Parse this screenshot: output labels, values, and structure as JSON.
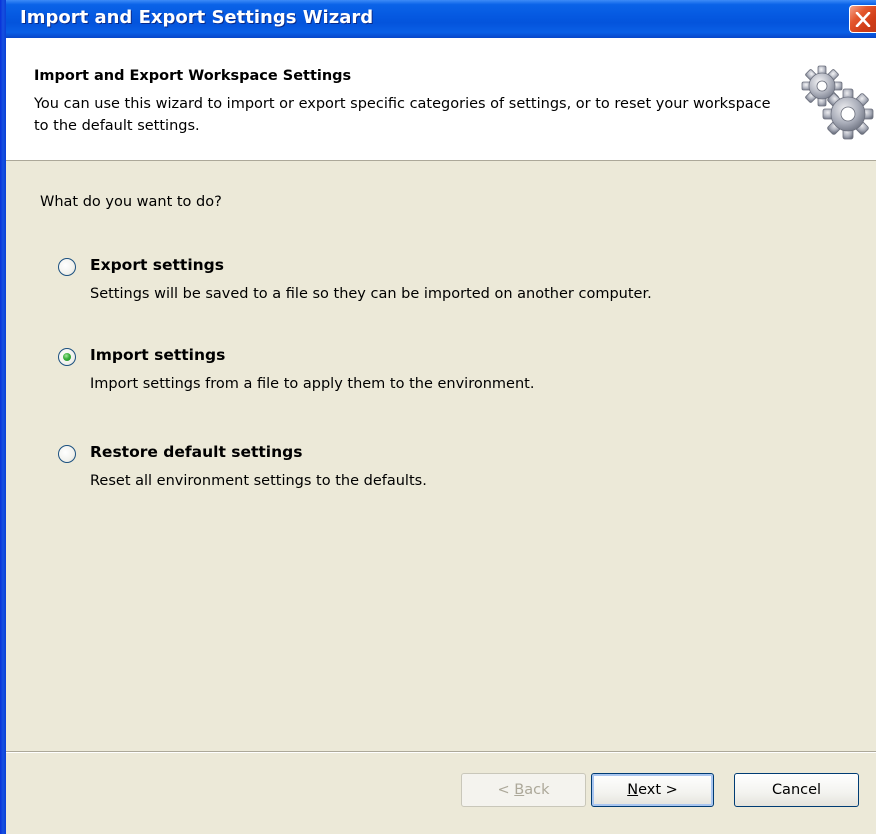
{
  "window": {
    "title": "Import and Export Settings Wizard",
    "close_icon": "close-icon"
  },
  "header": {
    "title": "Import and Export Workspace Settings",
    "description": "You can use this wizard to import or export specific categories of settings, or to reset your workspace to the default settings.",
    "icon": "gears-icon"
  },
  "main": {
    "question": "What do you want to do?",
    "options": [
      {
        "label": "Export settings",
        "description": "Settings will be saved to a file so they can be imported on another computer.",
        "selected": false
      },
      {
        "label": "Import settings",
        "description": "Import settings from a file to apply them to the environment.",
        "selected": true
      },
      {
        "label": "Restore default settings",
        "description": "Reset all environment settings to the defaults.",
        "selected": false
      }
    ]
  },
  "footer": {
    "back_prefix": "< ",
    "back_mnemonic": "B",
    "back_rest": "ack",
    "back_enabled": false,
    "next_mnemonic": "N",
    "next_rest": "ext >",
    "cancel_label": "Cancel"
  },
  "colors": {
    "title_bar": "#0558e0",
    "close_button": "#d03c16",
    "dialog_background": "#ece9d8",
    "radio_selected": "#39b13b",
    "button_border": "#003c74",
    "disabled_text": "#aca899"
  }
}
